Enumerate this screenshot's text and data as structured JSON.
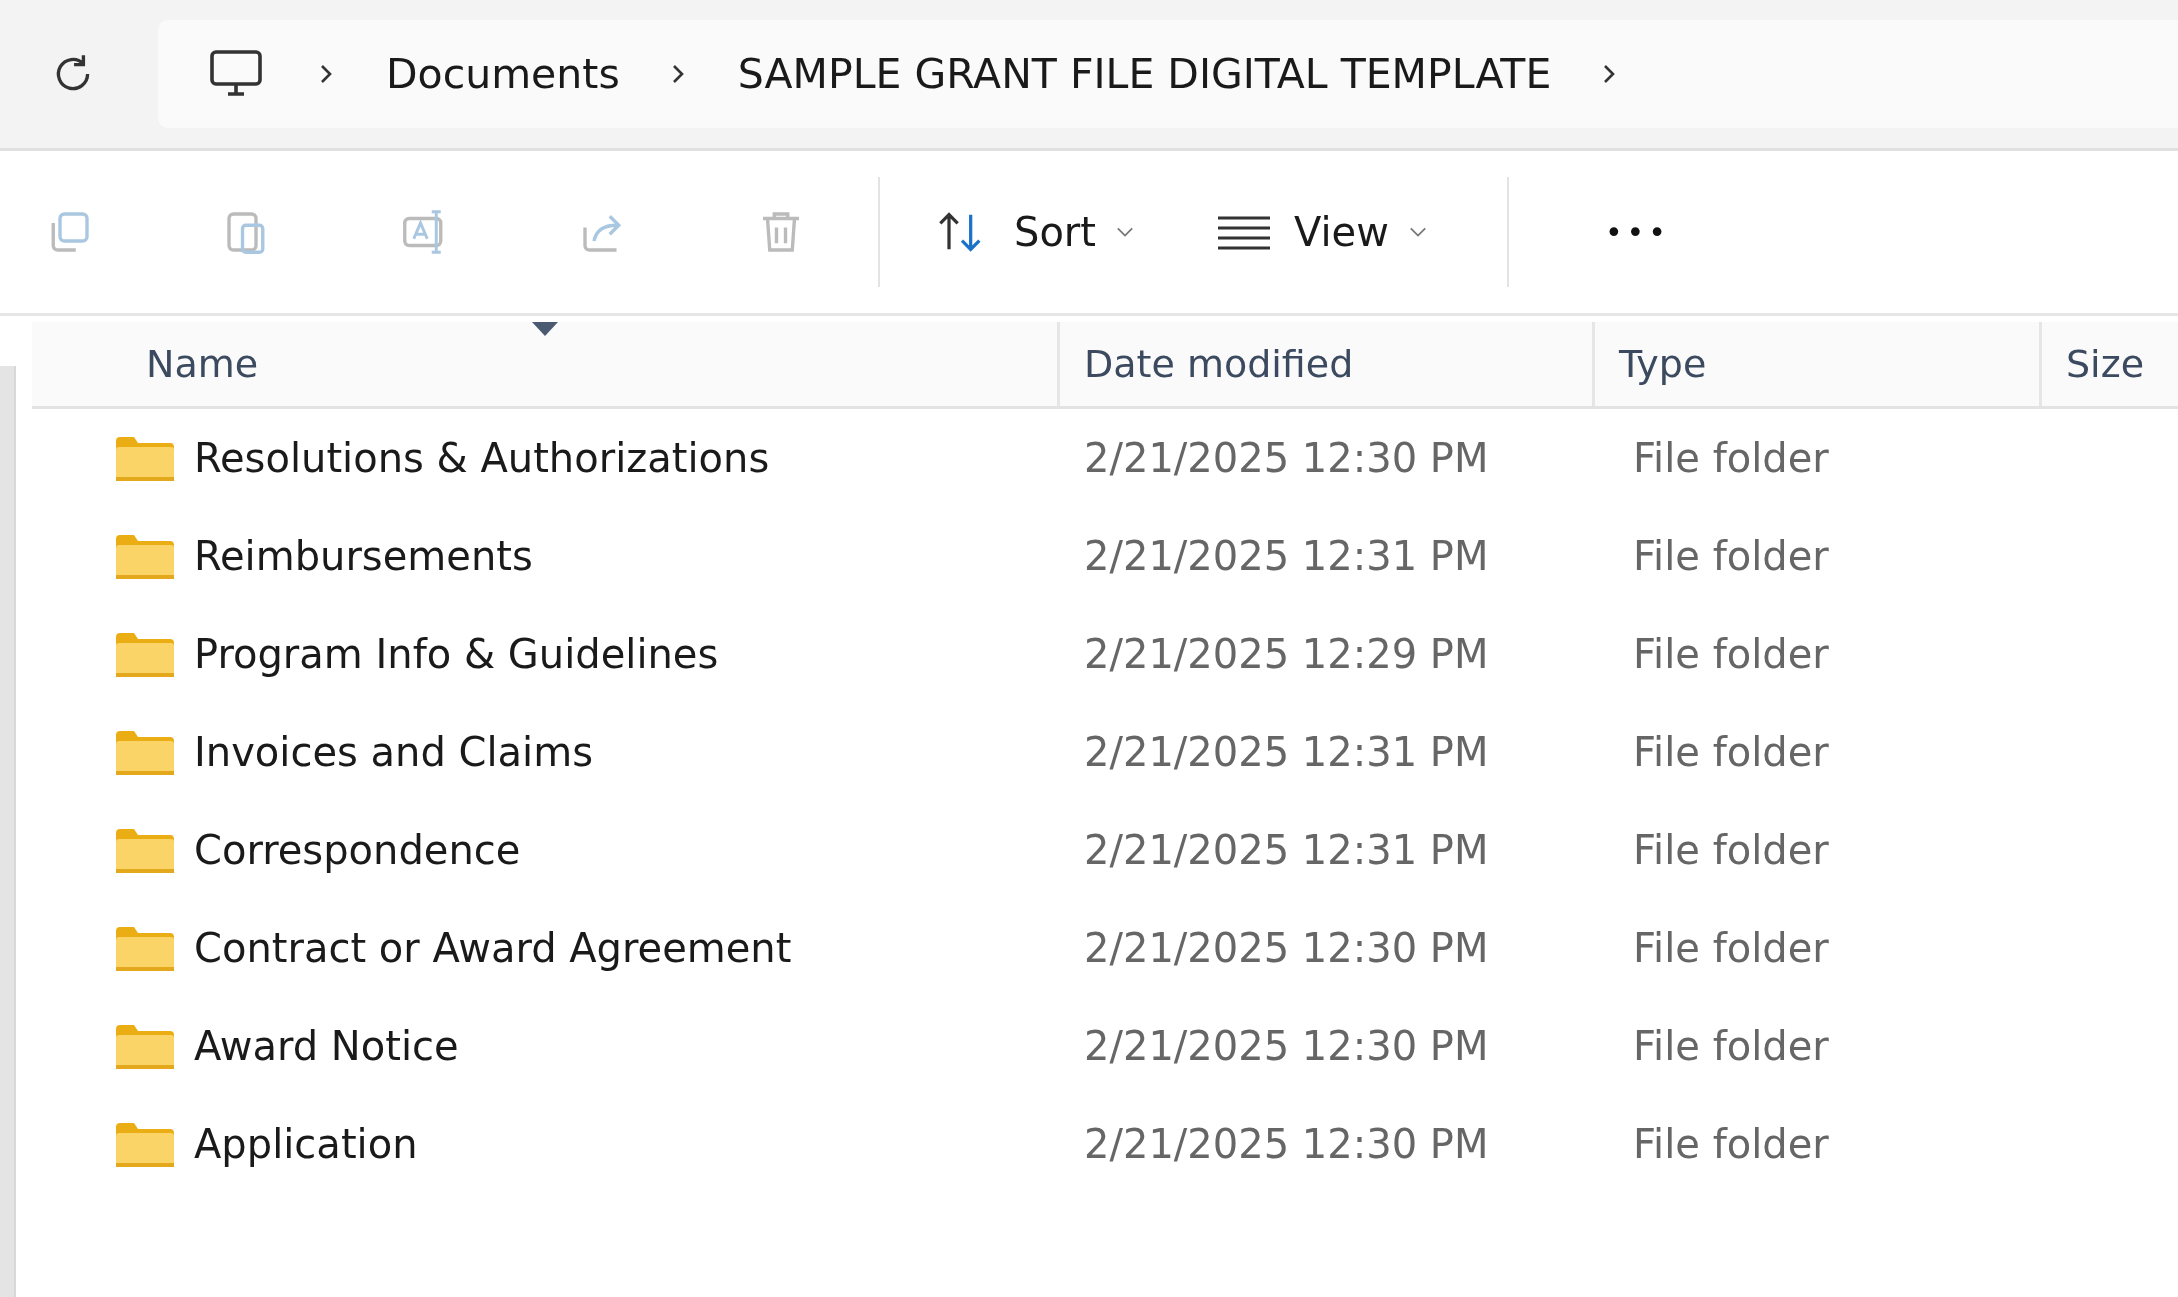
{
  "breadcrumb": [
    "Documents",
    "SAMPLE GRANT FILE DIGITAL TEMPLATE"
  ],
  "toolbar": {
    "sort": "Sort",
    "view": "View",
    "more": "•••"
  },
  "columns": [
    {
      "label": "Name",
      "sorted": true
    },
    {
      "label": "Date modified",
      "sorted": false
    },
    {
      "label": "Type",
      "sorted": false
    },
    {
      "label": "Size",
      "sorted": false
    }
  ],
  "rows": [
    {
      "name": "Resolutions & Authorizations",
      "date": "2/21/2025 12:30 PM",
      "type": "File folder"
    },
    {
      "name": "Reimbursements",
      "date": "2/21/2025 12:31 PM",
      "type": "File folder"
    },
    {
      "name": "Program Info & Guidelines",
      "date": "2/21/2025 12:29 PM",
      "type": "File folder"
    },
    {
      "name": "Invoices and Claims",
      "date": "2/21/2025 12:31 PM",
      "type": "File folder"
    },
    {
      "name": "Correspondence",
      "date": "2/21/2025 12:31 PM",
      "type": "File folder"
    },
    {
      "name": "Contract or Award Agreement",
      "date": "2/21/2025 12:30 PM",
      "type": "File folder"
    },
    {
      "name": "Award Notice",
      "date": "2/21/2025 12:30 PM",
      "type": "File folder"
    },
    {
      "name": "Application",
      "date": "2/21/2025 12:30 PM",
      "type": "File folder"
    }
  ]
}
